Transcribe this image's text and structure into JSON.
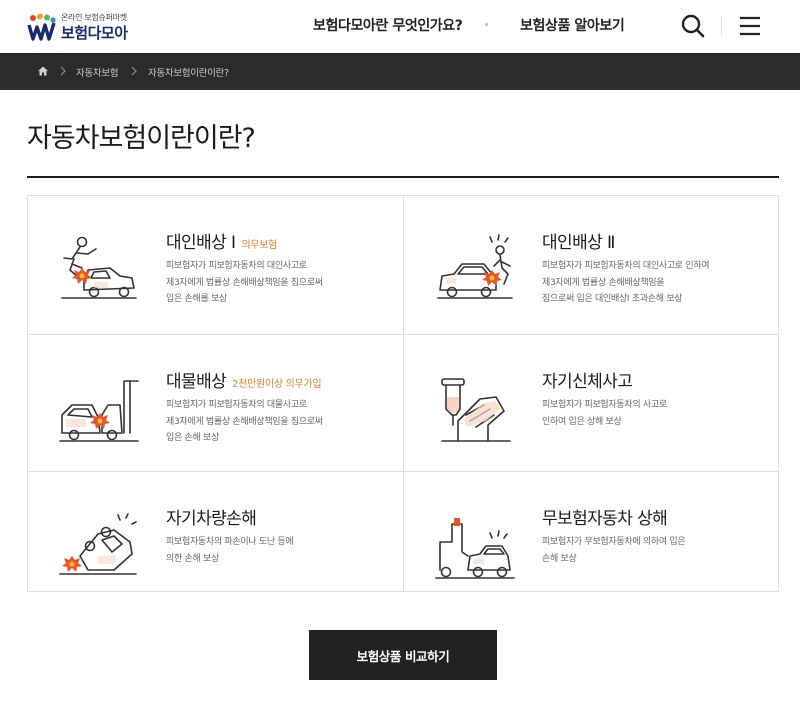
{
  "header": {
    "logo_tagline": "온라인 보험슈퍼마켓",
    "logo_name": "보험다모아",
    "nav": [
      {
        "label": "보험다모아란 무엇인가요?"
      },
      {
        "label": "보험상품 알아보기"
      }
    ]
  },
  "breadcrumb": {
    "items": [
      {
        "label": "자동차보험"
      },
      {
        "label": "자동차보험이란이란?"
      }
    ]
  },
  "page": {
    "title": "자동차보험이란이란?"
  },
  "coverages": [
    {
      "title": "대인배상 Ⅰ",
      "tag": "의무보험",
      "desc": [
        "피보험자가 피보험자동차의 대인사고로",
        "제3자에게 법률상 손해배상책임을 짐으로써",
        "입은 손해를 보상"
      ],
      "icon": "person-hit-by-car-icon"
    },
    {
      "title": "대인배상 Ⅱ",
      "tag": "",
      "desc": [
        "피보험자가 피보험자동차의 대인사고로 인하여",
        "제3자에게 법률상 손해배상책임을",
        "짐으로써 입은 대인배상Ⅰ 초과손해 보상"
      ],
      "icon": "car-hitting-person-icon"
    },
    {
      "title": "대물배상",
      "tag": "2천만원이상 의무가입",
      "desc": [
        "피보험자가 피보험자동차의 대물사고로",
        "제3자에게 법률상 손해배상책임을 짐으로써",
        "입은 손해 보상"
      ],
      "icon": "car-collision-icon"
    },
    {
      "title": "자기신체사고",
      "tag": "",
      "desc": [
        "피보험자가 피보험자동차의 사고로",
        "인하여 입은 상해 보상"
      ],
      "icon": "injured-arm-iv-icon"
    },
    {
      "title": "자기차량손해",
      "tag": "",
      "desc": [
        "피보험자동차의 파손이나 도난 등에",
        "의한 손해 보상"
      ],
      "icon": "overturned-car-icon"
    },
    {
      "title": "무보험자동차 상해",
      "tag": "",
      "desc": [
        "피보험자가 무보험자동차에 의하여 입은",
        "손해 보상"
      ],
      "icon": "towed-car-icon"
    }
  ],
  "cta": {
    "label": "보험상품 비교하기"
  },
  "colors": {
    "accent": "#e07b2a",
    "dark_bar": "#2b2b2b",
    "button": "#222222",
    "logo_navy": "#1c2b6b"
  }
}
